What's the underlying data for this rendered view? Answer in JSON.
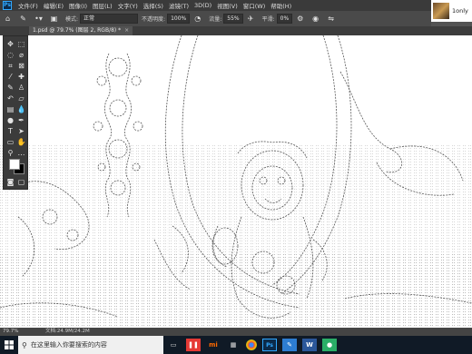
{
  "menubar": {
    "items": [
      "文件(F)",
      "编辑(E)",
      "图像(I)",
      "图层(L)",
      "文字(Y)",
      "选择(S)",
      "滤镜(T)",
      "3D(D)",
      "视图(V)",
      "窗口(W)",
      "帮助(H)"
    ]
  },
  "app_corner": {
    "label": "1only"
  },
  "options": {
    "mode_label": "模式:",
    "mode_value": "正常",
    "opacity_label": "不透明度:",
    "opacity_value": "100%",
    "flow_label": "流量:",
    "flow_value": "55%",
    "smooth_label": "平滑:",
    "smooth_value": "0%"
  },
  "tab": {
    "title": "1.psd @ 79.7% (图层 2, RGB/8) *",
    "close": "×"
  },
  "statusbar": {
    "zoom": "79.7%",
    "doc": "文档:24.9M/24.2M"
  },
  "taskbar": {
    "search_placeholder": "在这里输入你要搜索的内容"
  },
  "colors": {
    "foreground": "#ffffff",
    "background": "#000000",
    "accent": "#31a8ff"
  }
}
